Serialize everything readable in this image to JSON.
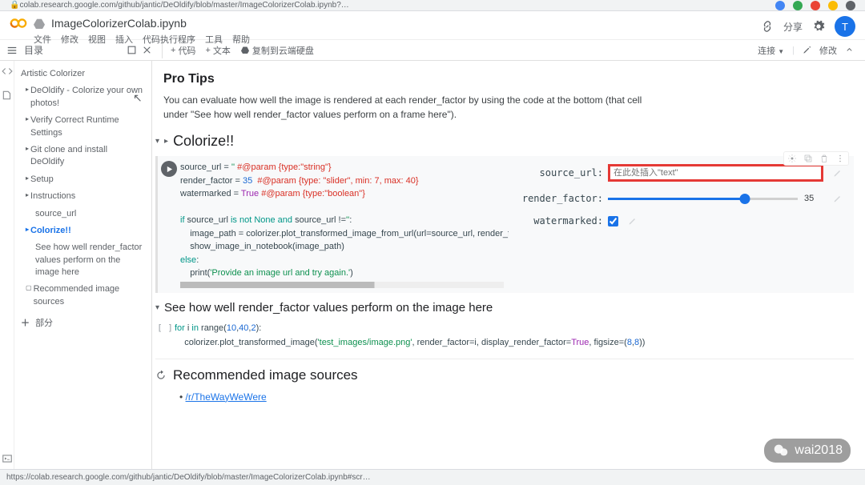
{
  "browser": {
    "url": "colab.research.google.com/github/jantic/DeOldify/blob/master/ImageColorizerColab.ipynb?…"
  },
  "header": {
    "notebook_name": "ImageColorizerColab.ipynb",
    "menu": [
      "文件",
      "修改",
      "视图",
      "插入",
      "代码执行程序",
      "工具",
      "帮助"
    ],
    "share": "分享",
    "avatar_initial": "T"
  },
  "toolbar": {
    "toc": "目录",
    "code": "代码",
    "text": "文本",
    "copy_drive": "复制到云端硬盘",
    "connect": "连接",
    "edit": "修改"
  },
  "toc": {
    "items": [
      {
        "label": "Artistic Colorizer",
        "level": 1,
        "marker": ""
      },
      {
        "label": "DeOldify - Colorize your own photos!",
        "level": 2,
        "marker": "tri"
      },
      {
        "label": "Verify Correct Runtime Settings",
        "level": 2,
        "marker": "tri"
      },
      {
        "label": "Git clone and install DeOldify",
        "level": 2,
        "marker": "tri"
      },
      {
        "label": "Setup",
        "level": 2,
        "marker": "tri"
      },
      {
        "label": "Instructions",
        "level": 2,
        "marker": "tri"
      },
      {
        "label": "source_url",
        "level": 3,
        "marker": ""
      },
      {
        "label": "Colorize!!",
        "level": 2,
        "marker": "tri",
        "active": true
      },
      {
        "label": "See how well render_factor values perform on the image here",
        "level": 3,
        "marker": ""
      },
      {
        "label": "Recommended image sources",
        "level": 2,
        "marker": "sq"
      },
      {
        "label": "部分",
        "level": 1,
        "marker": "plus"
      }
    ]
  },
  "main": {
    "protips_title": "Pro Tips",
    "protips_text": "You can evaluate how well the image is rendered at each render_factor by using the code at the bottom (that cell under \"See how well render_factor values perform on a frame here\").",
    "colorize_title": "Colorize!!",
    "form": {
      "source_url_label": "source_url:",
      "source_url_placeholder": "在此处插入\"text\"",
      "render_factor_label": "render_factor:",
      "render_factor_value": "35",
      "watermarked_label": "watermarked:"
    },
    "seehow_title": "See how well render_factor values perform on the image here",
    "reco_title": "Recommended image sources",
    "reco_link": "/r/TheWayWeWere"
  },
  "code": {
    "cell1": {
      "l1a": "source_url = ",
      "l1b": "''",
      "l1c": " #@param {type:\"string\"}",
      "l2a": "render_factor = ",
      "l2b": "35",
      "l2c": "  #@param {type: \"slider\", min: 7, max: 40}",
      "l3a": "watermarked = ",
      "l3b": "True",
      "l3c": " #@param {type:\"boolean\"}",
      "l4a": "if",
      "l4b": " source_url ",
      "l4c": "is not None and",
      "l4d": " source_url !=",
      "l4e": "''",
      "l4f": ":",
      "l5a": "    image_path = colorizer.plot_transformed_image_from_url(url=source_url, render_factor=re",
      "l6a": "    show_image_in_notebook(image_path)",
      "l7a": "else",
      "l7b": ":",
      "l8a": "    print(",
      "l8b": "'Provide an image url and try again.'",
      "l8c": ")"
    },
    "cell2": {
      "l1a": "for",
      "l1b": " i ",
      "l1c": "in",
      "l1d": " range(",
      "l1e": "10",
      "l1f": ",",
      "l1g": "40",
      "l1h": ",",
      "l1i": "2",
      "l1j": "):",
      "l2a": "    colorizer.plot_transformed_image(",
      "l2b": "'test_images/image.png'",
      "l2c": ", render_factor=i, display_render_factor=",
      "l2d": "True",
      "l2e": ", figsize=(",
      "l2f": "8",
      "l2g": ",",
      "l2h": "8",
      "l2i": "))"
    }
  },
  "footer": {
    "url": "https://colab.research.google.com/github/jantic/DeOldify/blob/master/ImageColorizerColab.ipynb#scr…"
  },
  "watermark": "wai2018"
}
